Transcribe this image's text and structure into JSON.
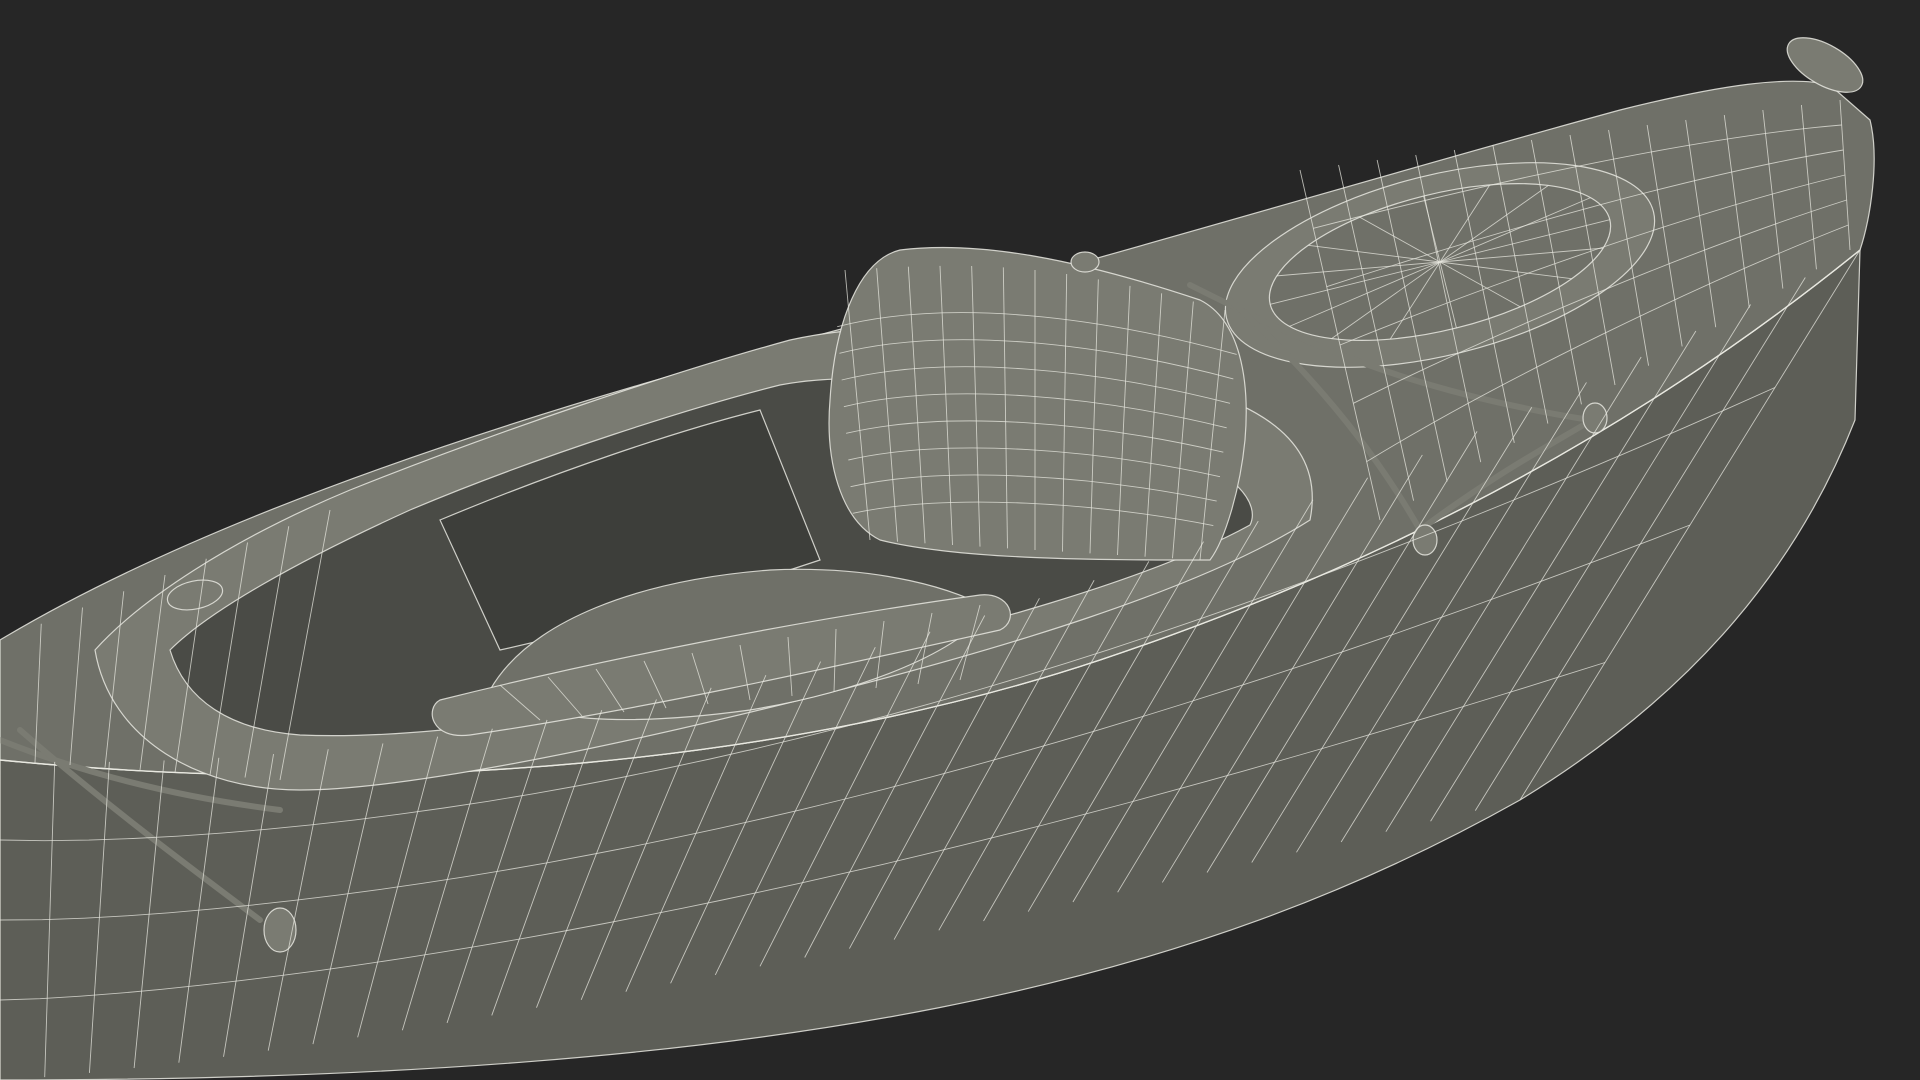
{
  "scene": {
    "background_color": "#262626",
    "surface_color": "#6f7068",
    "surface_light_color": "#7a7b72",
    "surface_shade_color": "#5d5e57",
    "cockpit_interior_color": "#4a4b46",
    "cockpit_deep_color": "#3d3e3a",
    "wire_color": "#e8e8e0"
  }
}
